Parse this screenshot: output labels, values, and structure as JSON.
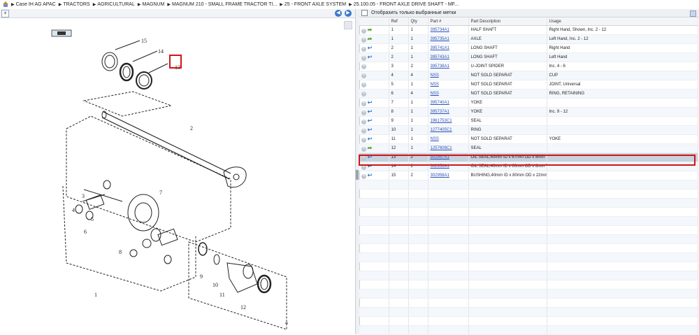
{
  "breadcrumb": [
    "Case IH AG APAC",
    "TRACTORS",
    "AGRICULTURAL",
    "MAGNUM",
    "MAGNUM 210 - SMALL FRAME TRACTOR TI...",
    "25 - FRONT AXLE SYSTEM",
    "25.100.05 - FRONT AXLE DRIVE SHAFT - MF..."
  ],
  "left_toolbar": {
    "zoom_label": "+"
  },
  "filter_label": "Отобразить только выбранные метки",
  "columns": [
    "Ref",
    "Qty",
    "Part #",
    "Part Description",
    "Usage"
  ],
  "rows": [
    {
      "ref": "1",
      "qty": "1",
      "part": "395734A1",
      "desc": "HALF SHAFT",
      "usage": "Right Hand, Shown, Inc. 2 - 12",
      "arrow": "green"
    },
    {
      "ref": "1",
      "qty": "1",
      "part": "395735A1",
      "desc": "AXLE",
      "usage": "Left Hand, Inc. 2 - 12",
      "arrow": "green"
    },
    {
      "ref": "2",
      "qty": "1",
      "part": "395741A1",
      "desc": "LONG SHAFT",
      "usage": "Right Hand",
      "arrow": "blue"
    },
    {
      "ref": "2",
      "qty": "1",
      "part": "395743A1",
      "desc": "LONG SHAFT",
      "usage": "Left Hand",
      "arrow": "blue"
    },
    {
      "ref": "3",
      "qty": "2",
      "part": "395738A1",
      "desc": "U-JOINT SPIDER",
      "usage": "Inc. 4 - 6",
      "arrow": ""
    },
    {
      "ref": "4",
      "qty": "4",
      "part": "NSS",
      "desc": "NOT SOLD SEPARAT",
      "usage": "CUP",
      "arrow": ""
    },
    {
      "ref": "5",
      "qty": "1",
      "part": "NSS",
      "desc": "NOT SOLD SEPARAT",
      "usage": "JOINT, Universal",
      "arrow": ""
    },
    {
      "ref": "6",
      "qty": "4",
      "part": "NSS",
      "desc": "NOT SOLD SEPARAT",
      "usage": "RING, RETAINING",
      "arrow": ""
    },
    {
      "ref": "7",
      "qty": "1",
      "part": "395740A1",
      "desc": "YOKE",
      "usage": "",
      "arrow": "blue"
    },
    {
      "ref": "8",
      "qty": "1",
      "part": "395737A1",
      "desc": "YOKE",
      "usage": "Inc. 9 - 12",
      "arrow": "blue"
    },
    {
      "ref": "9",
      "qty": "1",
      "part": "1961753C1",
      "desc": "SEAL",
      "usage": "",
      "arrow": "blue"
    },
    {
      "ref": "10",
      "qty": "1",
      "part": "1277405C1",
      "desc": "RING",
      "usage": "",
      "arrow": "blue"
    },
    {
      "ref": "11",
      "qty": "1",
      "part": "NSS",
      "desc": "NOT SOLD SEPARAT",
      "usage": "YOKE",
      "arrow": "blue"
    },
    {
      "ref": "12",
      "qty": "1",
      "part": "1257608C1",
      "desc": "SEAL",
      "usage": "",
      "arrow": "green"
    },
    {
      "ref": "13",
      "qty": "2",
      "part": "302957A1",
      "desc": "OIL SEAL,40mm ID x 67mm OD x 8mm Thk",
      "usage": "",
      "arrow": "blue",
      "selected": true
    },
    {
      "ref": "14",
      "qty": "2",
      "part": "302956A1",
      "desc": "OIL SEAL,40mm ID x 60mm OD x 8mm Thk",
      "usage": "",
      "arrow": "blue"
    },
    {
      "ref": "15",
      "qty": "2",
      "part": "302958A1",
      "desc": "BUSHING,40mm ID x 80mm OD x 22mm L",
      "usage": "",
      "arrow": "blue"
    }
  ],
  "diagram_callouts": [
    "15",
    "14",
    "13",
    "2",
    "1",
    "3",
    "4",
    "5",
    "6",
    "7",
    "8",
    "9",
    "10",
    "11",
    "12"
  ],
  "colors": {
    "accent": "#3b79c9",
    "highlight": "#d01515",
    "selected_row": "#c8d1de",
    "green_arrow": "#5aa02c"
  }
}
